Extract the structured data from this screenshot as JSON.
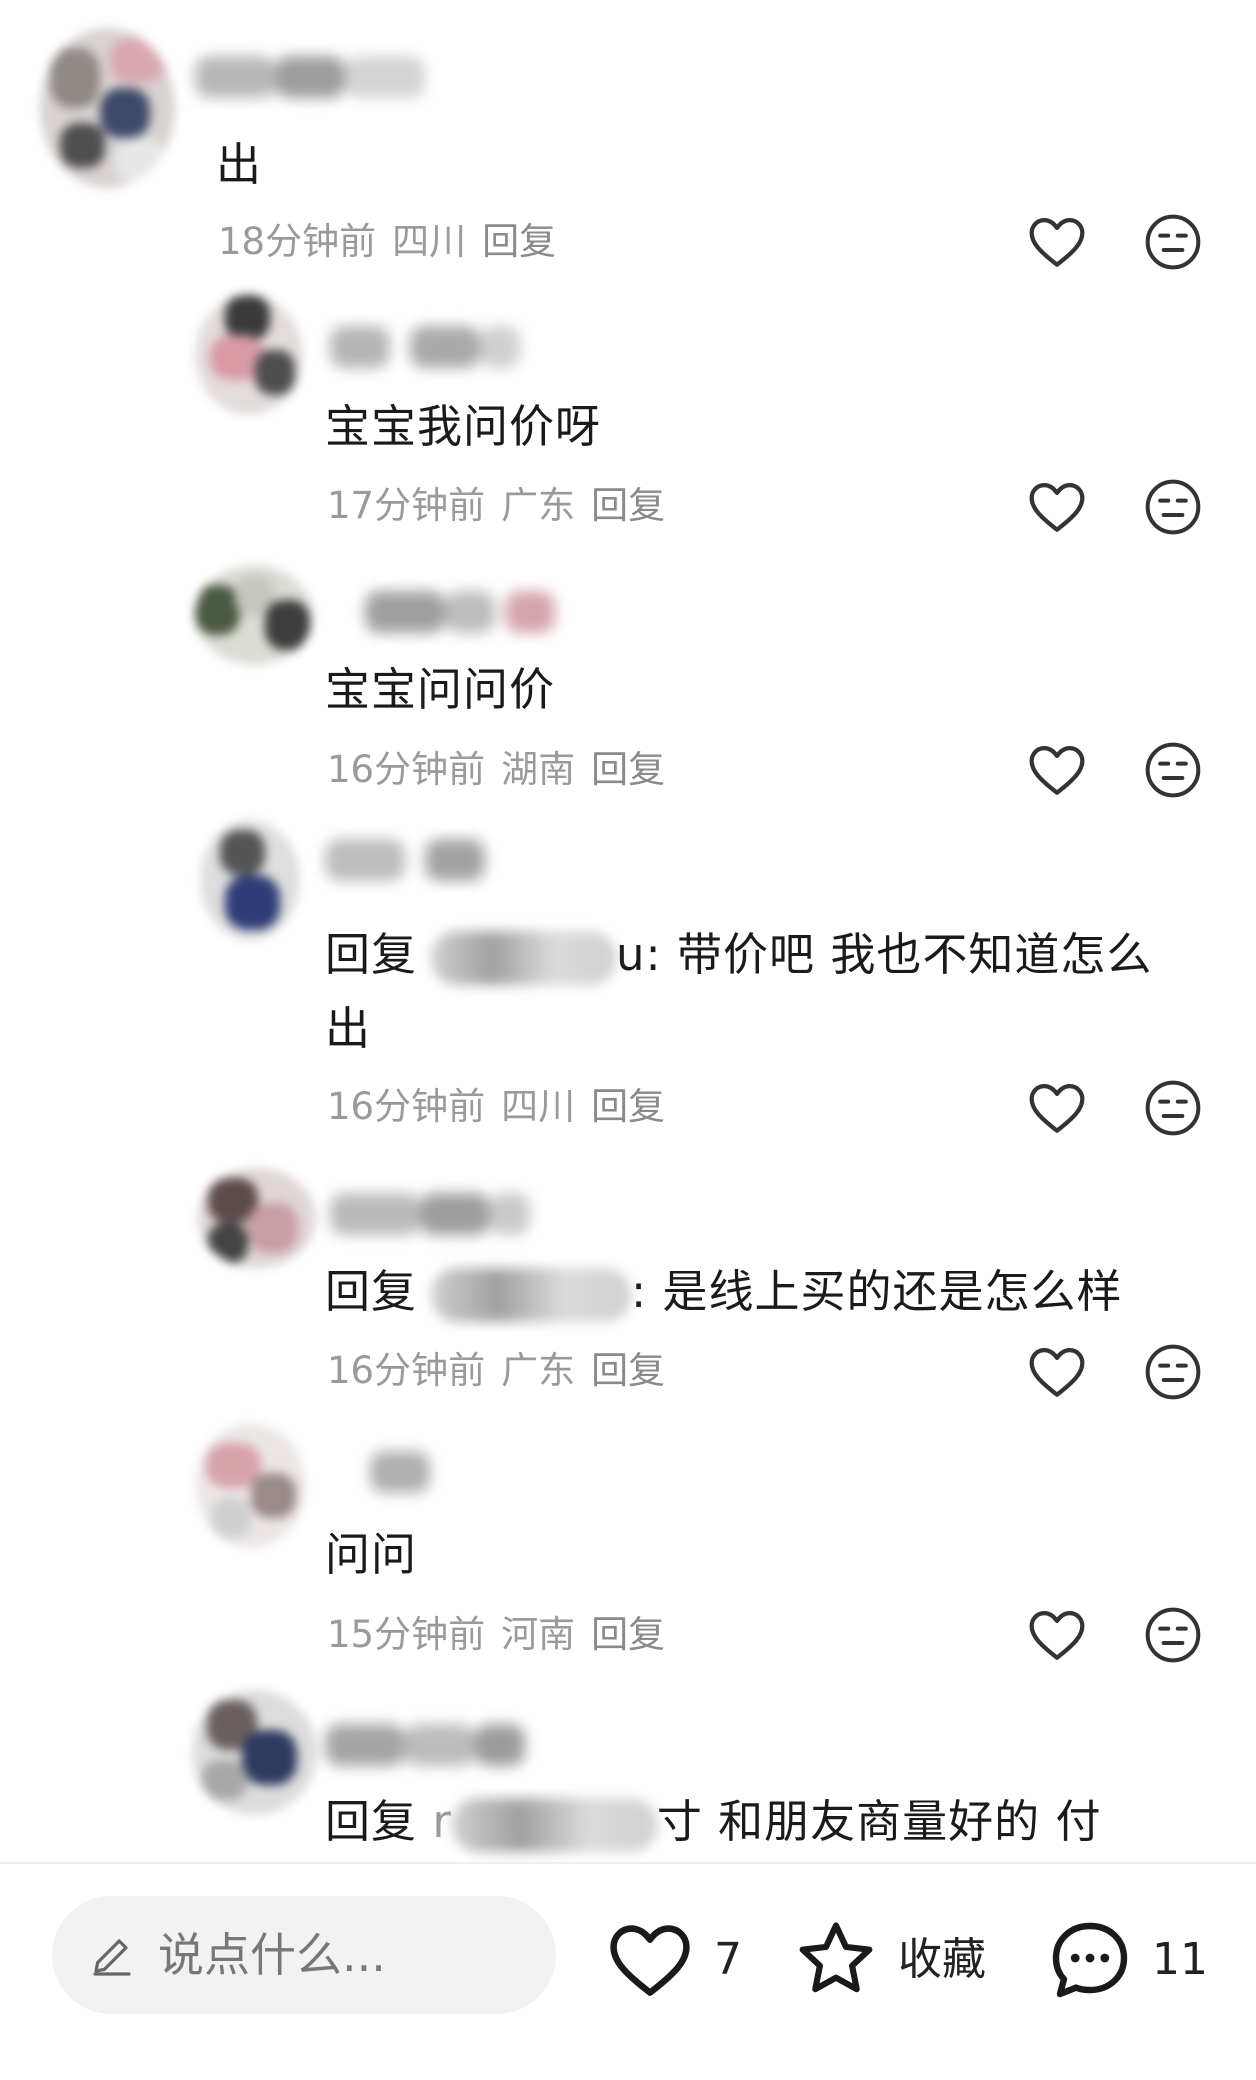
{
  "comments": [
    {
      "text": "出",
      "time": "18分钟前",
      "location": "四川",
      "reply": "回复"
    },
    {
      "text": "宝宝我问价呀",
      "time": "17分钟前",
      "location": "广东",
      "reply": "回复"
    },
    {
      "text": "宝宝问问价",
      "time": "16分钟前",
      "location": "湖南",
      "reply": "回复"
    },
    {
      "prefix": "回复",
      "mention_end": "u:",
      "text_line1": "带价吧 我也不知道怎么",
      "text_line2": "出",
      "time": "16分钟前",
      "location": "四川",
      "reply": "回复"
    },
    {
      "prefix": "回复",
      "mention_end": ":",
      "text": "是线上买的还是怎么样",
      "time": "16分钟前",
      "location": "广东",
      "reply": "回复"
    },
    {
      "text": "问问",
      "time": "15分钟前",
      "location": "河南",
      "reply": "回复"
    },
    {
      "prefix": "回复",
      "mention_start": "r",
      "text": "寸 和朋友商量好的 付"
    }
  ],
  "bottom_bar": {
    "input_placeholder": "说点什么...",
    "like_count": "7",
    "collect_label": "收藏",
    "comment_count": "11"
  },
  "icons": {
    "like": "heart-icon",
    "dislike": "neutral-face-icon",
    "edit": "pencil-icon",
    "collect": "star-icon",
    "comment": "chat-bubble-icon"
  },
  "colors": {
    "text": "#1a1a1a",
    "meta": "#9a9a9a",
    "icon": "#333333",
    "input_bg": "#f2f2f2"
  }
}
